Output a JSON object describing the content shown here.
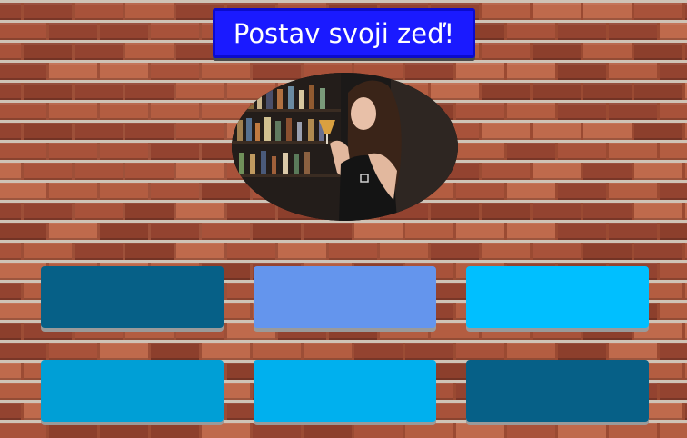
{
  "header": {
    "title": "Postav svoji zeď!"
  },
  "image": {
    "icon": "woman-with-drink-photo"
  },
  "tiles": [
    {
      "color": "#066087"
    },
    {
      "color": "#6495ed"
    },
    {
      "color": "#00bfff"
    },
    {
      "color": "#009fd6"
    },
    {
      "color": "#00b0ee"
    },
    {
      "color": "#066087"
    }
  ],
  "background": {
    "icon": "brick-wall-texture"
  }
}
